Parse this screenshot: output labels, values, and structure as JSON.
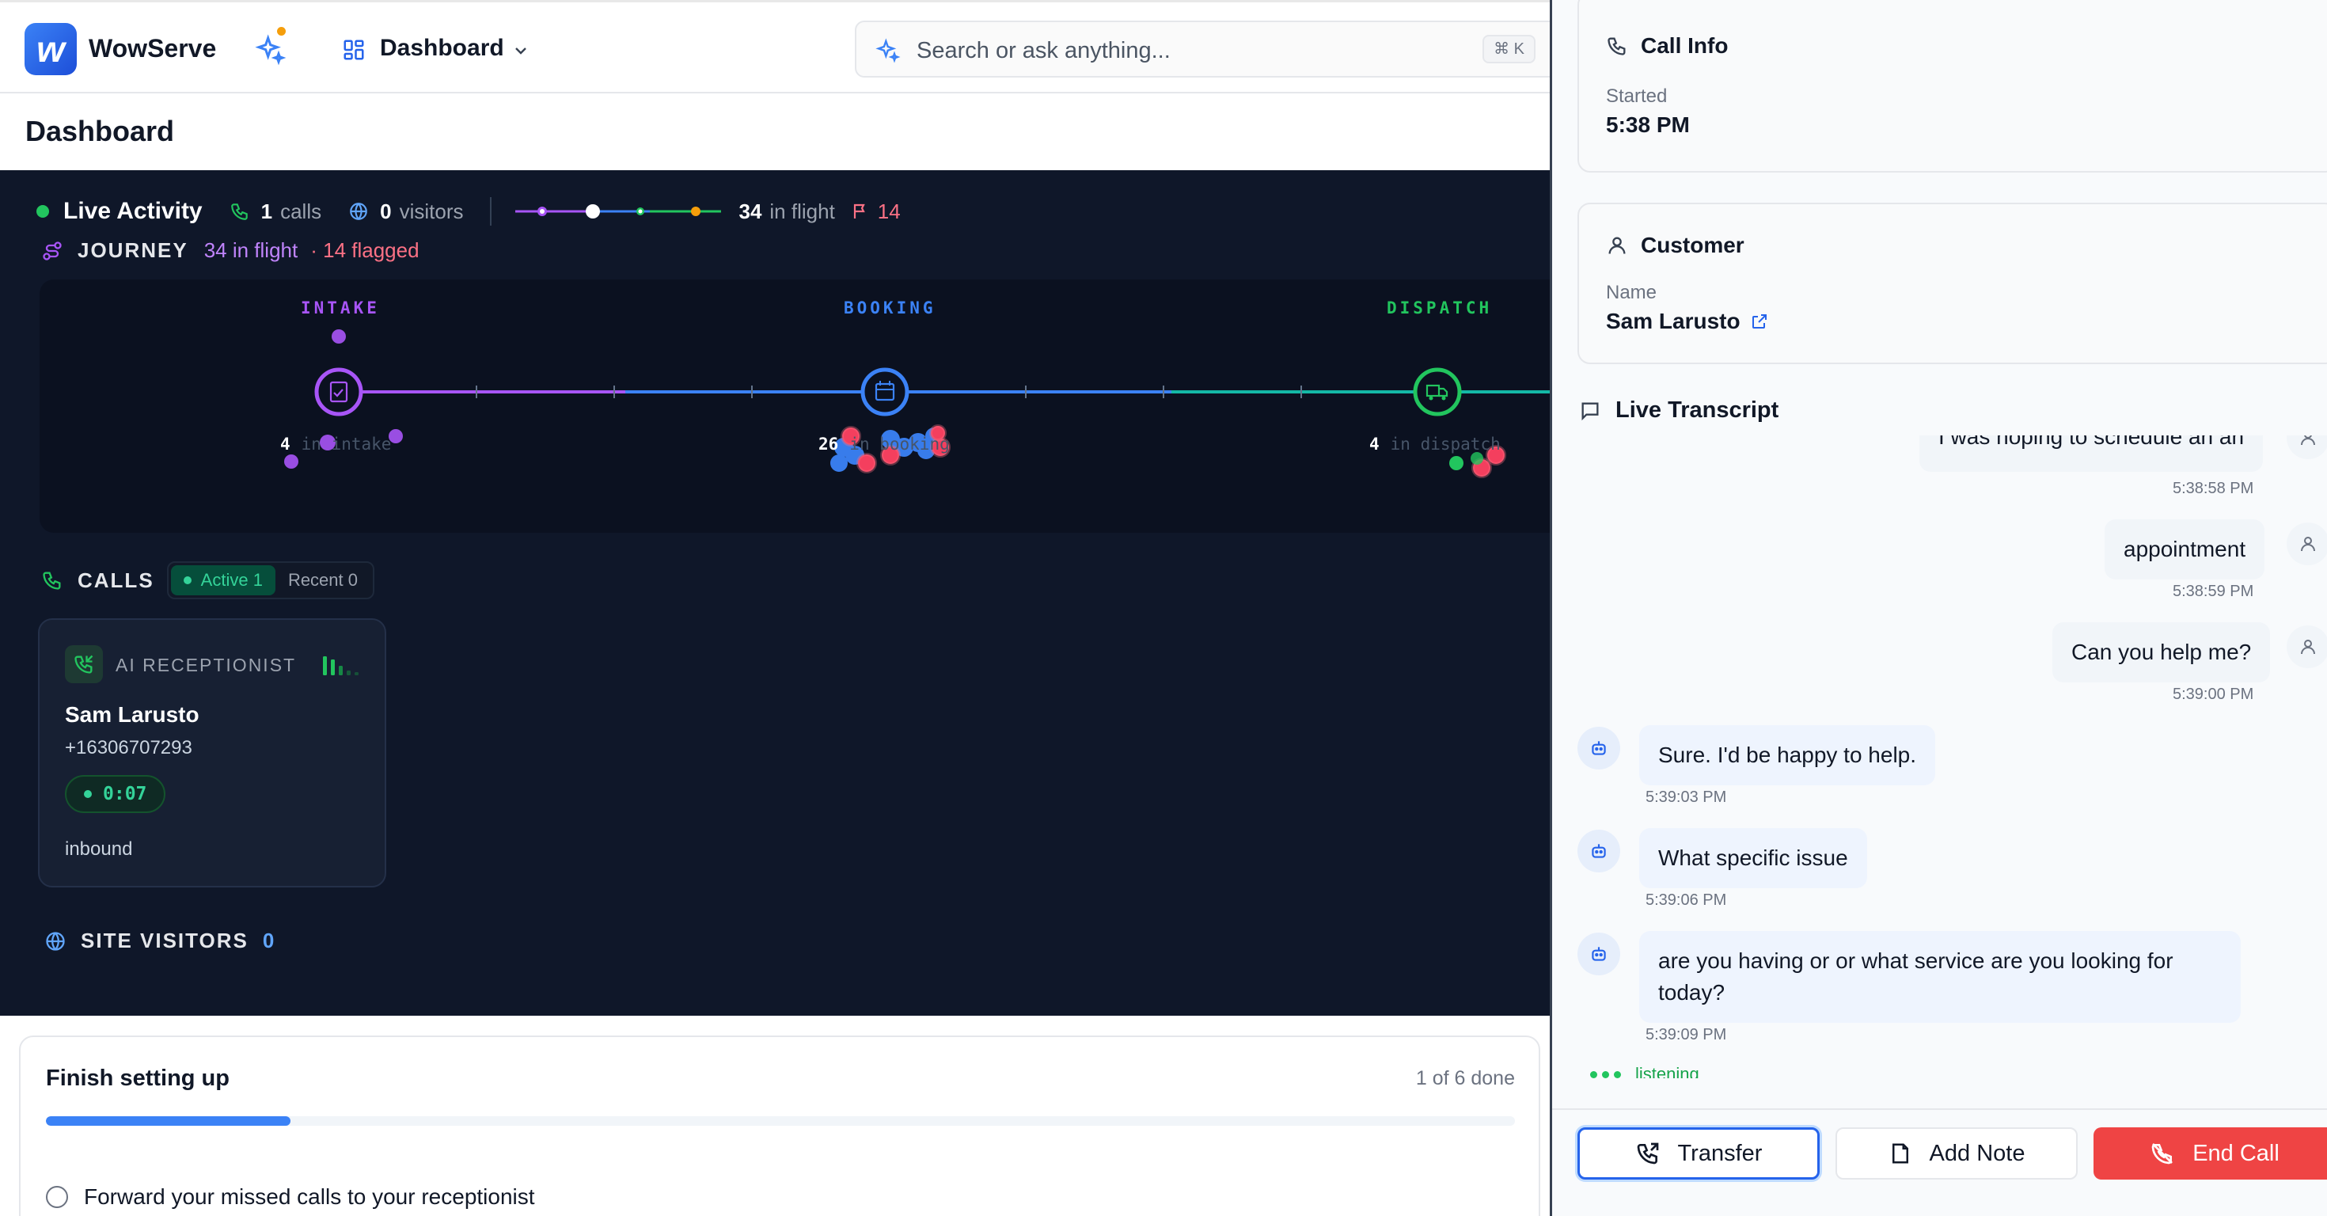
{
  "app": {
    "brand": "WowServe",
    "logo_letter": "w",
    "nav_label": "Dashboard",
    "search_placeholder": "Search or ask anything...",
    "search_shortcut": "⌘ K"
  },
  "page": {
    "title": "Dashboard"
  },
  "live_activity": {
    "title": "Live Activity",
    "calls_count": "1",
    "calls_label": "calls",
    "visitors_count": "0",
    "visitors_label": "visitors",
    "in_flight_count": "34",
    "in_flight_label": "in flight",
    "flag_count": "14"
  },
  "journey": {
    "title": "JOURNEY",
    "in_flight": "34 in flight",
    "flagged": "· 14 flagged",
    "stages": [
      {
        "label": "INTAKE",
        "count": "4",
        "sub": "in intake",
        "color": "#a855f7"
      },
      {
        "label": "BOOKING",
        "count": "26",
        "sub": "in booking",
        "color": "#3b82f6"
      },
      {
        "label": "DISPATCH",
        "count": "4",
        "sub": "in dispatch",
        "color": "#22c55e"
      }
    ]
  },
  "calls": {
    "title": "CALLS",
    "tab_active": "Active 1",
    "tab_recent": "Recent 0",
    "card": {
      "role": "AI RECEPTIONIST",
      "name": "Sam Larusto",
      "phone": "+16306707293",
      "timer": "0:07",
      "direction": "inbound"
    }
  },
  "site_visitors": {
    "title": "SITE VISITORS",
    "count": "0"
  },
  "setup": {
    "title": "Finish setting up",
    "progress_text": "1 of 6 done",
    "progress_fraction": 0.1667,
    "task_1": "Forward your missed calls to your receptionist"
  },
  "panel": {
    "call_info": {
      "title": "Call Info",
      "started_label": "Started",
      "started_value": "5:38 PM"
    },
    "customer": {
      "title": "Customer",
      "name_label": "Name",
      "name_value": "Sam Larusto"
    },
    "transcript_title": "Live Transcript",
    "messages": [
      {
        "role": "user",
        "text": "I was hoping to schedule an an",
        "time": "5:38:58 PM"
      },
      {
        "role": "user",
        "text": "appointment",
        "time": "5:38:59 PM"
      },
      {
        "role": "user",
        "text": "Can you help me?",
        "time": "5:39:00 PM"
      },
      {
        "role": "ai",
        "text": "Sure. I'd be happy to help.",
        "time": "5:39:03 PM"
      },
      {
        "role": "ai",
        "text": "What specific issue",
        "time": "5:39:06 PM"
      },
      {
        "role": "ai",
        "text": "are you having or or what service are you looking for today?",
        "time": "5:39:09 PM"
      }
    ],
    "listening": "listening",
    "actions": {
      "transfer": "Transfer",
      "note": "Add Note",
      "end": "End Call"
    }
  },
  "colors": {
    "accent": "#2563eb",
    "live_bg": "#0f1729",
    "danger": "#ef4444",
    "success": "#22c55e"
  }
}
